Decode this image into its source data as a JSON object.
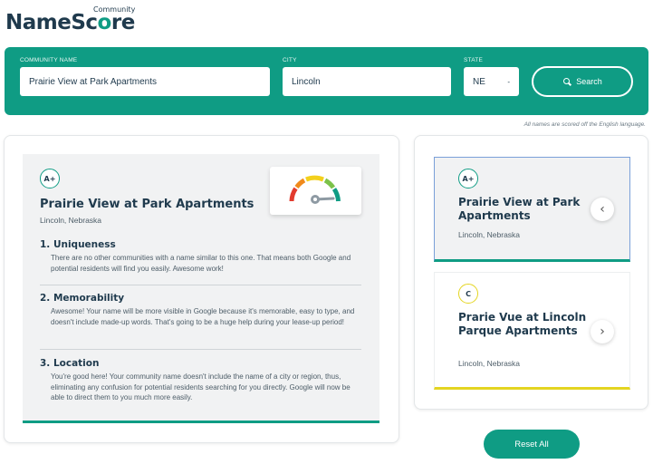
{
  "logo": {
    "community": "Community",
    "name_part1": "NameSc",
    "name_o": "o",
    "name_part2": "re"
  },
  "search": {
    "community_name": {
      "label": "COMMUNITY NAME",
      "value": "Prairie View at Park Apartments"
    },
    "city": {
      "label": "CITY",
      "value": "Lincoln"
    },
    "state": {
      "label": "STATE",
      "value": "NE",
      "caret": "-"
    },
    "search_label": "Search"
  },
  "english_note": "All names are scored off the English language.",
  "detail": {
    "grade": "A+",
    "title": "Prairie View at Park Apartments",
    "location": "Lincoln, Nebraska",
    "sections": [
      {
        "heading": "1. Uniqueness",
        "body": "There are no other communities with a name similar to this one. That means both Google and potential residents will find you easily. Awesome work!"
      },
      {
        "heading": "2. Memorability",
        "body": "Awesome! Your name will be more visible in Google because it's memorable, easy to type, and doesn't include made-up words. That's going to be a huge help during your lease-up period!"
      },
      {
        "heading": "3. Location",
        "body": "You're good here! Your community name doesn't include the name of a city or region, thus, eliminating any confusion for potential residents searching for you directly. Google will now be able to direct them to you much more easily."
      }
    ]
  },
  "results": [
    {
      "grade": "A+",
      "name": "Prairie View at Park Apartments",
      "location": "Lincoln, Nebraska",
      "arrow": "‹",
      "arrow_icon": "chevron-left-icon",
      "accent": "#0f9c84"
    },
    {
      "grade": "C",
      "name": "Prarie Vue at Lincoln Parque Apartments",
      "location": "Lincoln, Nebraska",
      "arrow": "›",
      "arrow_icon": "chevron-right-icon",
      "accent": "#e4d521"
    }
  ],
  "reset_label": "Reset All",
  "colors": {
    "brand": "#0f9c84",
    "navy": "#1f3a4d",
    "grade_c": "#e4d521"
  }
}
